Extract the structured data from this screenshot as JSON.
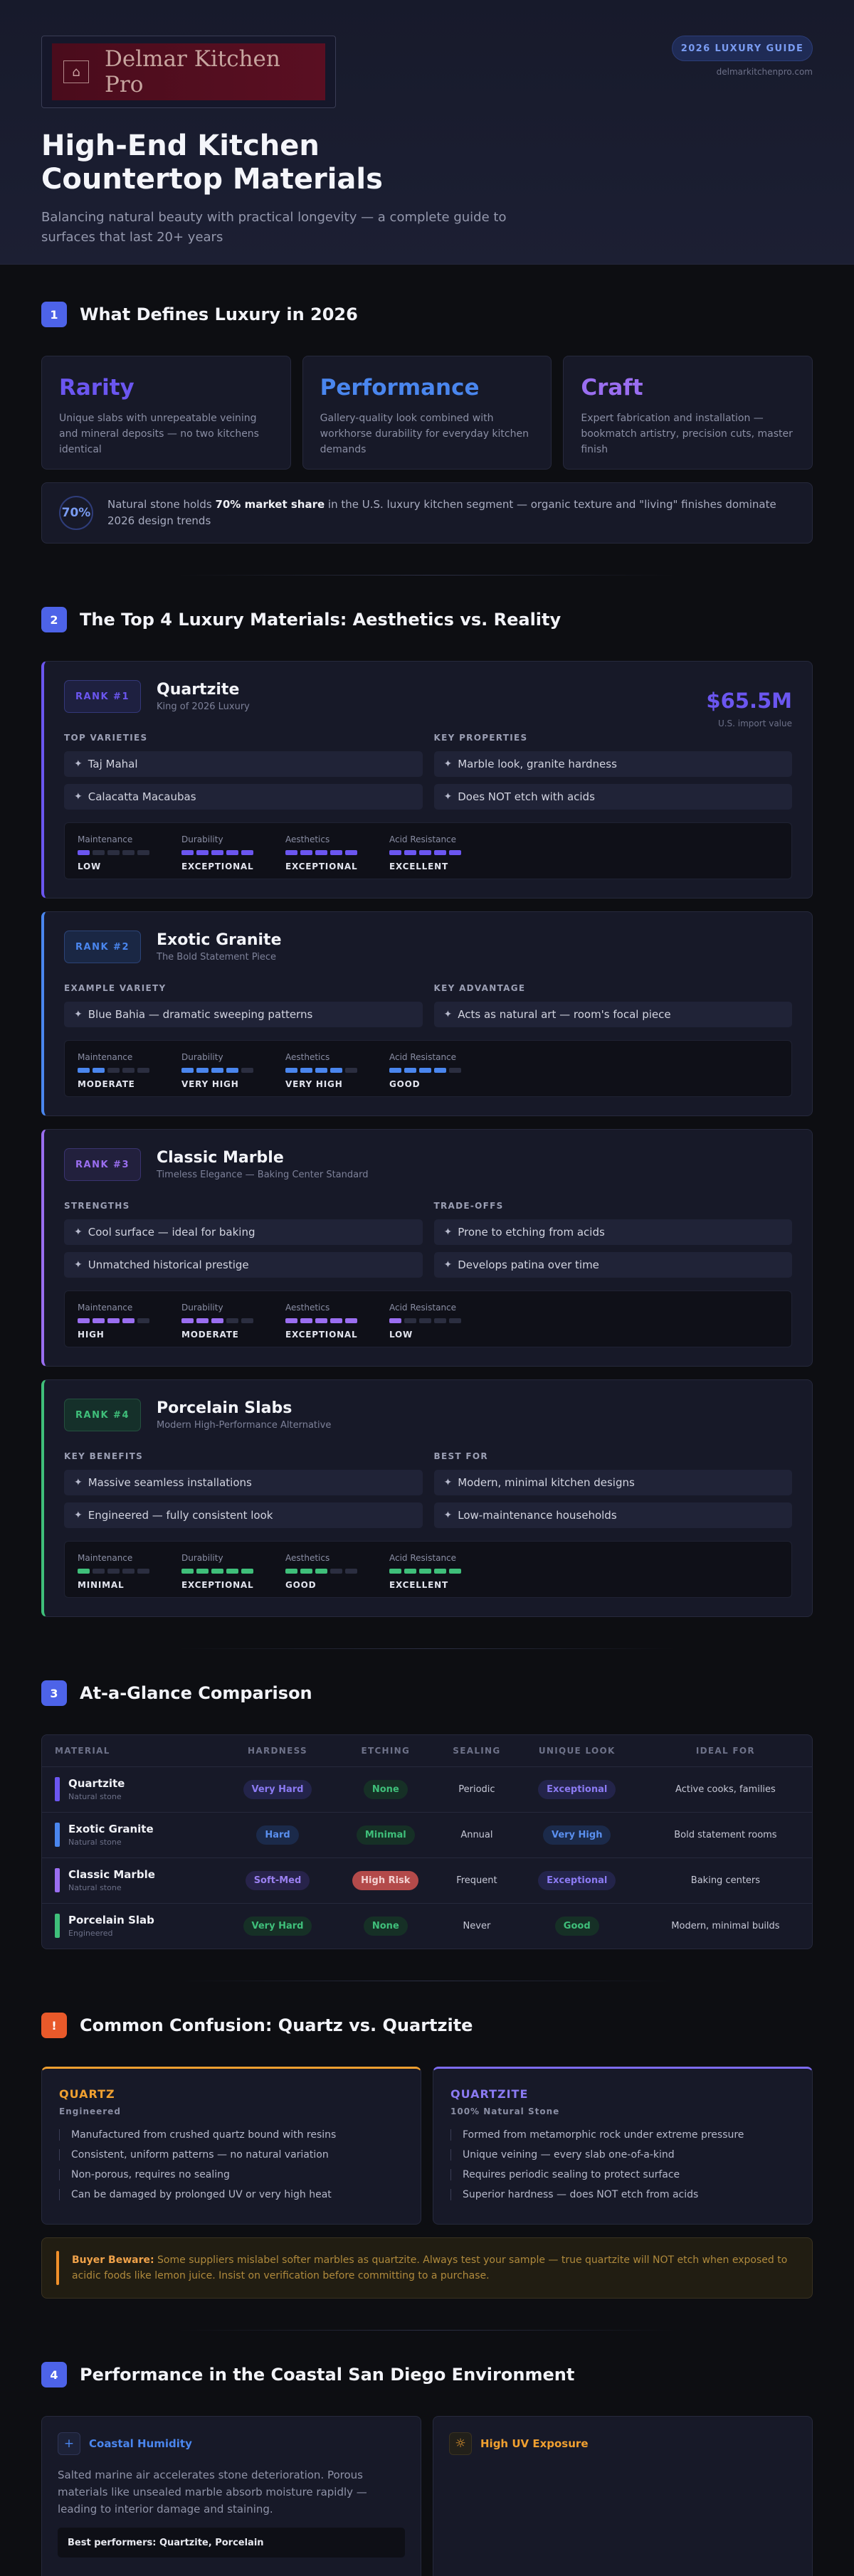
{
  "header": {
    "logo_text": "Delmar Kitchen Pro",
    "badge": "2026 LUXURY GUIDE",
    "site": "delmarkitchenpro.com",
    "title_line1": "High-End Kitchen",
    "title_line2": "Countertop Materials",
    "subtitle": "Balancing natural beauty with practical longevity — a complete guide to surfaces that last 20+ years"
  },
  "colors": {
    "accent": "#4d63e8",
    "rarity": "#6b56f0",
    "performance": "#4a86ee",
    "craft": "#9a6ef0",
    "quartzite": "#6b56f0",
    "granite": "#4a86ee",
    "marble": "#9a6ef0",
    "porcelain": "#3fbf7a",
    "warn": "#f0902a"
  },
  "section1": {
    "num": "1",
    "title": "What Defines Luxury in 2026",
    "cards": [
      {
        "title": "Rarity",
        "text": "Unique slabs with unrepeatable veining and mineral deposits — no two kitchens identical"
      },
      {
        "title": "Performance",
        "text": "Gallery-quality look combined with workhorse durability for everyday kitchen demands"
      },
      {
        "title": "Craft",
        "text": "Expert fabrication and installation — bookmatch artistry, precision cuts, master finish"
      }
    ],
    "stat": {
      "value": "70%",
      "pre": "Natural stone holds ",
      "bold": "70% market share",
      "post": " in the U.S. luxury kitchen segment — organic texture and \"living\" finishes dominate 2026 design trends"
    }
  },
  "section2": {
    "num": "2",
    "title": "The Top 4 Luxury Materials: Aesthetics vs. Reality",
    "meter_labels": [
      "Maintenance",
      "Durability",
      "Aesthetics",
      "Acid Resistance"
    ],
    "materials": [
      {
        "rank": "RANK #1",
        "name": "Quartzite",
        "tag": "King of 2026 Luxury",
        "price": "$65.5M",
        "price_label": "U.S. import value",
        "left_head": "TOP VARIETIES",
        "left": [
          "Taj Mahal",
          "Calacatta Macaubas"
        ],
        "right_head": "KEY PROPERTIES",
        "right": [
          "Marble look, granite hardness",
          "Does NOT etch with acids"
        ],
        "levels": [
          "LOW",
          "EXCEPTIONAL",
          "EXCEPTIONAL",
          "EXCELLENT"
        ],
        "fills": [
          1,
          5,
          5,
          5
        ]
      },
      {
        "rank": "RANK #2",
        "name": "Exotic Granite",
        "tag": "The Bold Statement Piece",
        "left_head": "EXAMPLE VARIETY",
        "left": [
          "Blue Bahia — dramatic sweeping patterns"
        ],
        "right_head": "KEY ADVANTAGE",
        "right": [
          "Acts as natural art — room's focal piece"
        ],
        "levels": [
          "MODERATE",
          "VERY HIGH",
          "VERY HIGH",
          "GOOD"
        ],
        "fills": [
          2,
          4,
          4,
          4
        ]
      },
      {
        "rank": "RANK #3",
        "name": "Classic Marble",
        "tag": "Timeless Elegance — Baking Center Standard",
        "left_head": "STRENGTHS",
        "left": [
          "Cool surface — ideal for baking",
          "Unmatched historical prestige"
        ],
        "right_head": "TRADE-OFFS",
        "right": [
          "Prone to etching from acids",
          "Develops patina over time"
        ],
        "levels": [
          "HIGH",
          "MODERATE",
          "EXCEPTIONAL",
          "LOW"
        ],
        "fills": [
          4,
          3,
          5,
          1
        ]
      },
      {
        "rank": "RANK #4",
        "name": "Porcelain Slabs",
        "tag": "Modern High-Performance Alternative",
        "left_head": "KEY BENEFITS",
        "left": [
          "Massive seamless installations",
          "Engineered — fully consistent look"
        ],
        "right_head": "BEST FOR",
        "right": [
          "Modern, minimal kitchen designs",
          "Low-maintenance households"
        ],
        "levels": [
          "MINIMAL",
          "EXCEPTIONAL",
          "GOOD",
          "EXCELLENT"
        ],
        "fills": [
          1,
          5,
          3,
          5
        ]
      }
    ]
  },
  "section3": {
    "num": "3",
    "title": "At-a-Glance Comparison",
    "headers": [
      "MATERIAL",
      "HARDNESS",
      "ETCHING",
      "SEALING",
      "UNIQUE LOOK",
      "IDEAL FOR"
    ],
    "rows": [
      {
        "name": "Quartzite",
        "sub": "Natural stone",
        "hardness": "Very Hard",
        "etching": "None",
        "sealing": "Periodic",
        "look": "Exceptional",
        "ideal": "Active cooks, families"
      },
      {
        "name": "Exotic Granite",
        "sub": "Natural stone",
        "hardness": "Hard",
        "etching": "Minimal",
        "sealing": "Annual",
        "look": "Very High",
        "ideal": "Bold statement rooms"
      },
      {
        "name": "Classic Marble",
        "sub": "Natural stone",
        "hardness": "Soft-Med",
        "etching": "High Risk",
        "sealing": "Frequent",
        "look": "Exceptional",
        "ideal": "Baking centers"
      },
      {
        "name": "Porcelain Slab",
        "sub": "Engineered",
        "hardness": "Very Hard",
        "etching": "None",
        "sealing": "Never",
        "look": "Good",
        "ideal": "Modern, minimal builds"
      }
    ]
  },
  "section4": {
    "num": "!",
    "title": "Common Confusion: Quartz vs. Quartzite",
    "quartz": {
      "title": "QUARTZ",
      "kind": "Engineered",
      "items": [
        "Manufactured from crushed quartz bound with resins",
        "Consistent, uniform patterns — no natural variation",
        "Non-porous, requires no sealing",
        "Can be damaged by prolonged UV or very high heat"
      ]
    },
    "quartzite": {
      "title": "QUARTZITE",
      "kind": "100% Natural Stone",
      "items": [
        "Formed from metamorphic rock under extreme pressure",
        "Unique veining — every slab one-of-a-kind",
        "Requires periodic sealing to protect surface",
        "Superior hardness — does NOT etch from acids"
      ]
    },
    "beware_bold": "Buyer Beware:",
    "beware_text": " Some suppliers mislabel softer marbles as quartzite. Always test your sample — true quartzite will NOT etch when exposed to acidic foods like lemon juice. Insist on verification before committing to a purchase."
  },
  "section5": {
    "num": "4",
    "title": "Performance in the Coastal San Diego Environment",
    "humidity": {
      "title": "Coastal Humidity",
      "text": "Salted marine air accelerates stone deterioration. Porous materials like unsealed marble absorb moisture rapidly — leading to interior damage and staining.",
      "best": "Best performers: Quartzite, Porcelain"
    },
    "uv": {
      "title": "High UV Exposure"
    }
  }
}
